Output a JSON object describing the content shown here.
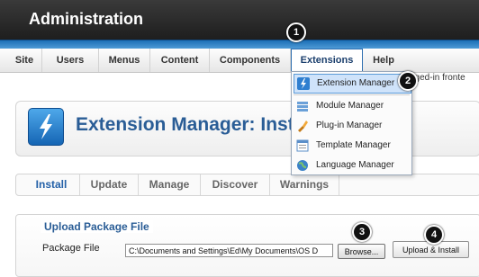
{
  "header": {
    "title": "Administration"
  },
  "menubar": {
    "items": [
      {
        "label": "Site"
      },
      {
        "label": "Users"
      },
      {
        "label": "Menus"
      },
      {
        "label": "Content"
      },
      {
        "label": "Components"
      },
      {
        "label": "Extensions"
      },
      {
        "label": "Help"
      }
    ],
    "logged_in_text": "gged-in fronte"
  },
  "extensions_menu": {
    "items": [
      {
        "label": "Extension Manager",
        "icon": "extension-manager-icon"
      },
      {
        "label": "Module Manager",
        "icon": "module-manager-icon"
      },
      {
        "label": "Plug-in Manager",
        "icon": "plugin-manager-icon"
      },
      {
        "label": "Template Manager",
        "icon": "template-manager-icon"
      },
      {
        "label": "Language Manager",
        "icon": "language-manager-icon"
      }
    ]
  },
  "callouts": [
    "1",
    "2",
    "3",
    "4"
  ],
  "page": {
    "title": "Extension Manager: Insta",
    "icon": "lightning-icon"
  },
  "tabs": [
    {
      "label": "Install"
    },
    {
      "label": "Update"
    },
    {
      "label": "Manage"
    },
    {
      "label": "Discover"
    },
    {
      "label": "Warnings"
    }
  ],
  "upload": {
    "legend": "Upload Package File",
    "field_label": "Package File",
    "file_value": "C:\\Documents and Settings\\Ed\\My Documents\\OS D",
    "browse_label": "Browse...",
    "install_label": "Upload & Install"
  },
  "colors": {
    "header_bg": "#2b2b2b",
    "accent_blue": "#1c6fb6",
    "title_blue": "#2a5d96",
    "menu_highlight": "#cfe3fa"
  }
}
